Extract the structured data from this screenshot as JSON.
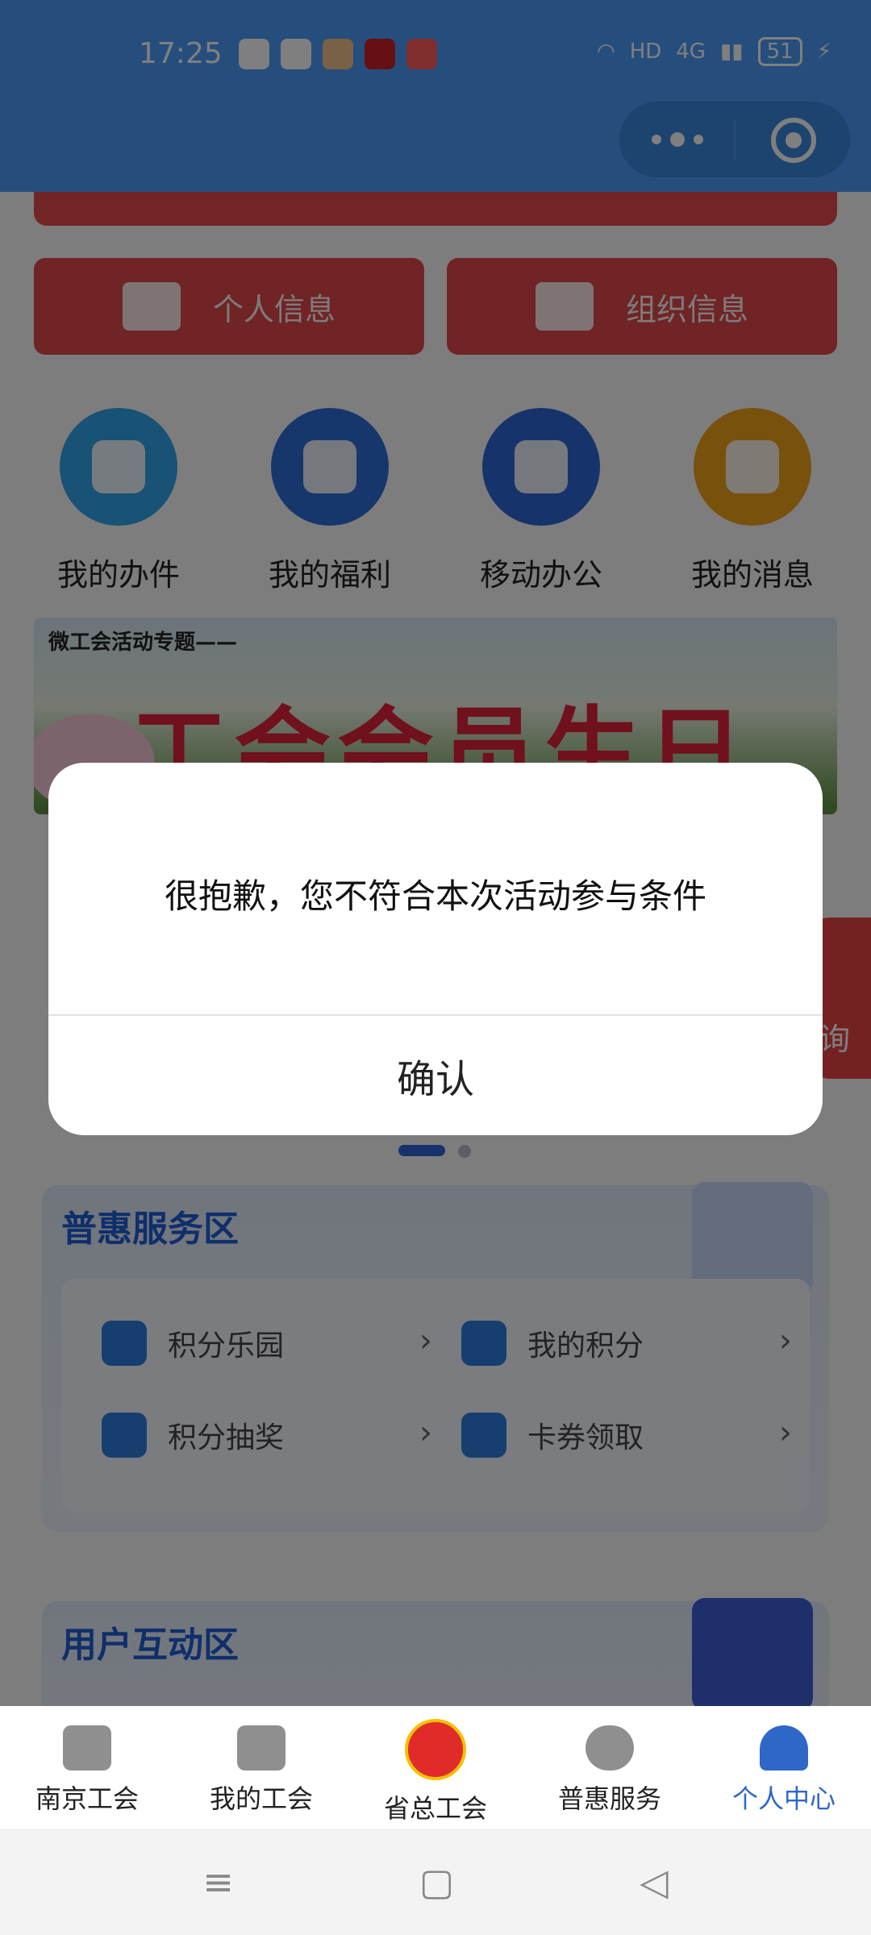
{
  "status_bar": {
    "time": "17:25",
    "hd": "HD",
    "network": "4G",
    "battery": "51"
  },
  "cards": [
    {
      "label": "个人信息"
    },
    {
      "label": "组织信息"
    }
  ],
  "quick_links": [
    {
      "label": "我的办件",
      "color": "#30a4e8"
    },
    {
      "label": "我的福利",
      "color": "#2f6fd8"
    },
    {
      "label": "移动办公",
      "color": "#2e66d6"
    },
    {
      "label": "我的消息",
      "color": "#f0a21a"
    }
  ],
  "banner": {
    "subtitle": "微工会活动专题——",
    "title": "工会会员生日月"
  },
  "side_button": {
    "label": "询"
  },
  "section1": {
    "title": "普惠服务区",
    "items": [
      {
        "label": "积分乐园"
      },
      {
        "label": "我的积分"
      },
      {
        "label": "积分抽奖"
      },
      {
        "label": "卡券领取"
      }
    ]
  },
  "section2": {
    "title": "用户互动区"
  },
  "modal": {
    "message": "很抱歉，您不符合本次活动参与条件",
    "confirm": "确认"
  },
  "tabbar": [
    {
      "label": "南京工会"
    },
    {
      "label": "我的工会"
    },
    {
      "label": "省总工会"
    },
    {
      "label": "普惠服务"
    },
    {
      "label": "个人中心"
    }
  ]
}
